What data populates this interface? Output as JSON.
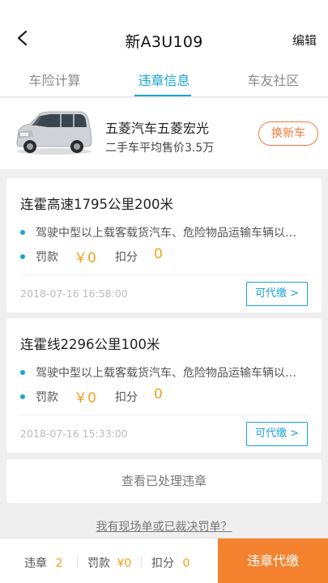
{
  "header": {
    "title": "新A3U109",
    "edit_label": "编辑"
  },
  "tabs": [
    {
      "label": "车险计算",
      "active": false
    },
    {
      "label": "违章信息",
      "active": true
    },
    {
      "label": "车友社区",
      "active": false
    }
  ],
  "car": {
    "name": "五菱汽车五菱宏光",
    "price": "二手车平均售价3.5万",
    "change_label": "换新车"
  },
  "violations": [
    {
      "title": "连霍高速1795公里200米",
      "desc": "驾驶中型以上载客载货汽车、危险物品运输车辆以外的其他机动车行驶超过规定时速",
      "fine_label": "罚款",
      "fine_value": "￥0",
      "points_label": "扣分",
      "points_value": "0",
      "time": "2018-07-16 16:58:00",
      "pay_label": "可代缴 >"
    },
    {
      "title": "连霍线2296公里100米",
      "desc": "驾驶中型以上载客载货汽车、危险物品运输车辆以外的其他机动车行驶超过规定时速",
      "fine_label": "罚款",
      "fine_value": "￥0",
      "points_label": "扣分",
      "points_value": "0",
      "time": "2018-07-16 15:33:00",
      "pay_label": "可代缴 >"
    }
  ],
  "processed_label": "查看已处理违章",
  "ticket_link": "我有现场单或已裁决罚单？",
  "bottom": {
    "violations_label": "违章",
    "violations_count": "2",
    "fine_label": "罚款",
    "fine_value": "¥0",
    "points_label": "扣分",
    "points_value": "0",
    "pay_all_label": "违章代缴"
  },
  "colors": {
    "accent_blue": "#1aa3d4",
    "accent_orange": "#f4822f",
    "value_orange": "#f0a020"
  }
}
